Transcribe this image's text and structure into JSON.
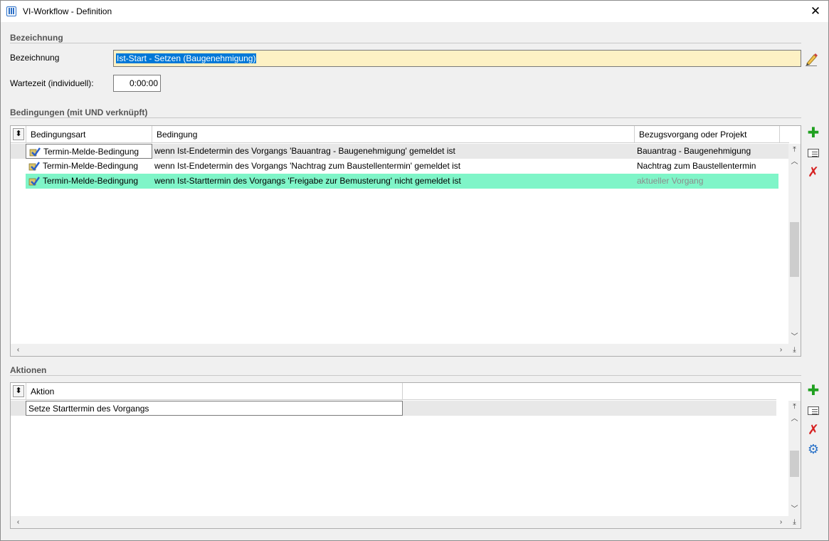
{
  "window": {
    "title": "VI-Workflow - Definition"
  },
  "bezeichnung": {
    "section_title": "Bezeichnung",
    "name_label": "Bezeichnung",
    "name_value": "Ist-Start - Setzen (Baugenehmigung)",
    "wait_label": "Wartezeit (individuell):",
    "wait_value": "0:00:00"
  },
  "conditions": {
    "section_title": "Bedingungen (mit UND verknüpft)",
    "columns": [
      "Bedingungsart",
      "Bedingung",
      "Bezugsvorgang oder Projekt"
    ],
    "rows": [
      {
        "type": "Termin-Melde-Bedingung",
        "condition": "wenn Ist-Endetermin des Vorgangs 'Bauantrag - Baugenehmigung' gemeldet ist",
        "reference": "Bauantrag - Baugenehmigung"
      },
      {
        "type": "Termin-Melde-Bedingung",
        "condition": "wenn Ist-Endetermin des Vorgangs 'Nachtrag zum Baustellentermin' gemeldet ist",
        "reference": "Nachtrag zum Baustellentermin"
      },
      {
        "type": "Termin-Melde-Bedingung",
        "condition": "wenn Ist-Starttermin des Vorgangs 'Freigabe zur Bemusterung' nicht gemeldet ist",
        "reference": "aktueller Vorgang"
      }
    ]
  },
  "actions": {
    "section_title": "Aktionen",
    "columns": [
      "Aktion"
    ],
    "rows": [
      {
        "action": "Setze Starttermin des Vorgangs"
      }
    ]
  },
  "colors": {
    "highlight_row": "#7ff5c8",
    "name_input_bg": "#fdf1c4",
    "selection": "#0078d7"
  },
  "icons": [
    "app-icon",
    "close-icon",
    "edit-pencil-icon",
    "sort-toggle-icon",
    "add-icon",
    "properties-icon",
    "delete-icon",
    "settings-gear-icon"
  ]
}
